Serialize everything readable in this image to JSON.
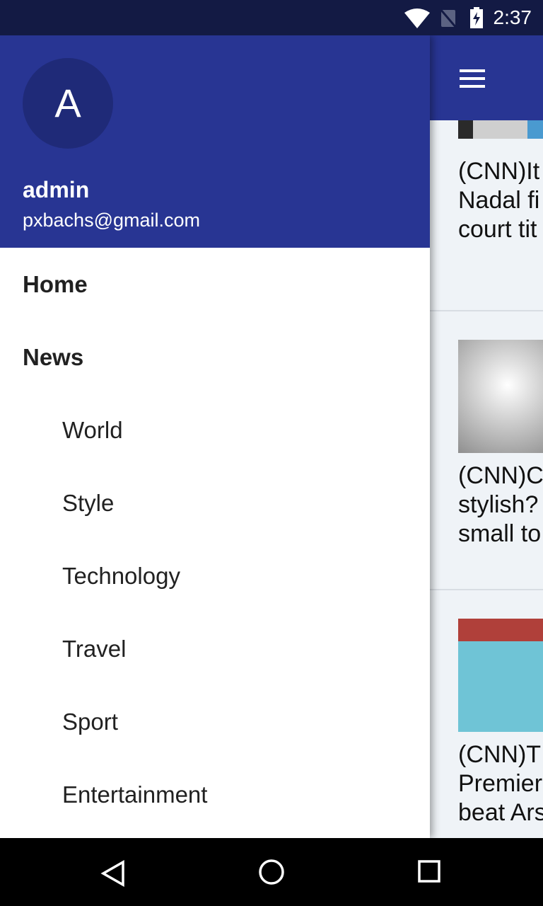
{
  "status_bar": {
    "time": "2:37"
  },
  "drawer": {
    "avatar_letter": "A",
    "username": "admin",
    "email": "pxbachs@gmail.com",
    "items": [
      {
        "label": "Home"
      },
      {
        "label": "News"
      },
      {
        "label": "World"
      },
      {
        "label": "Style"
      },
      {
        "label": "Technology"
      },
      {
        "label": "Travel"
      },
      {
        "label": "Sport"
      },
      {
        "label": "Entertainment"
      }
    ]
  },
  "feed": {
    "articles": [
      {
        "title_lines": [
          "(CNN)It",
          "Nadal fi",
          "court tit"
        ]
      },
      {
        "title_lines": [
          "(CNN)C",
          "stylish?",
          "small to"
        ]
      },
      {
        "title_lines": [
          "(CNN)T",
          "Premier",
          "beat Ars"
        ]
      }
    ]
  },
  "colors": {
    "primary": "#283593",
    "status": "#131a44"
  }
}
